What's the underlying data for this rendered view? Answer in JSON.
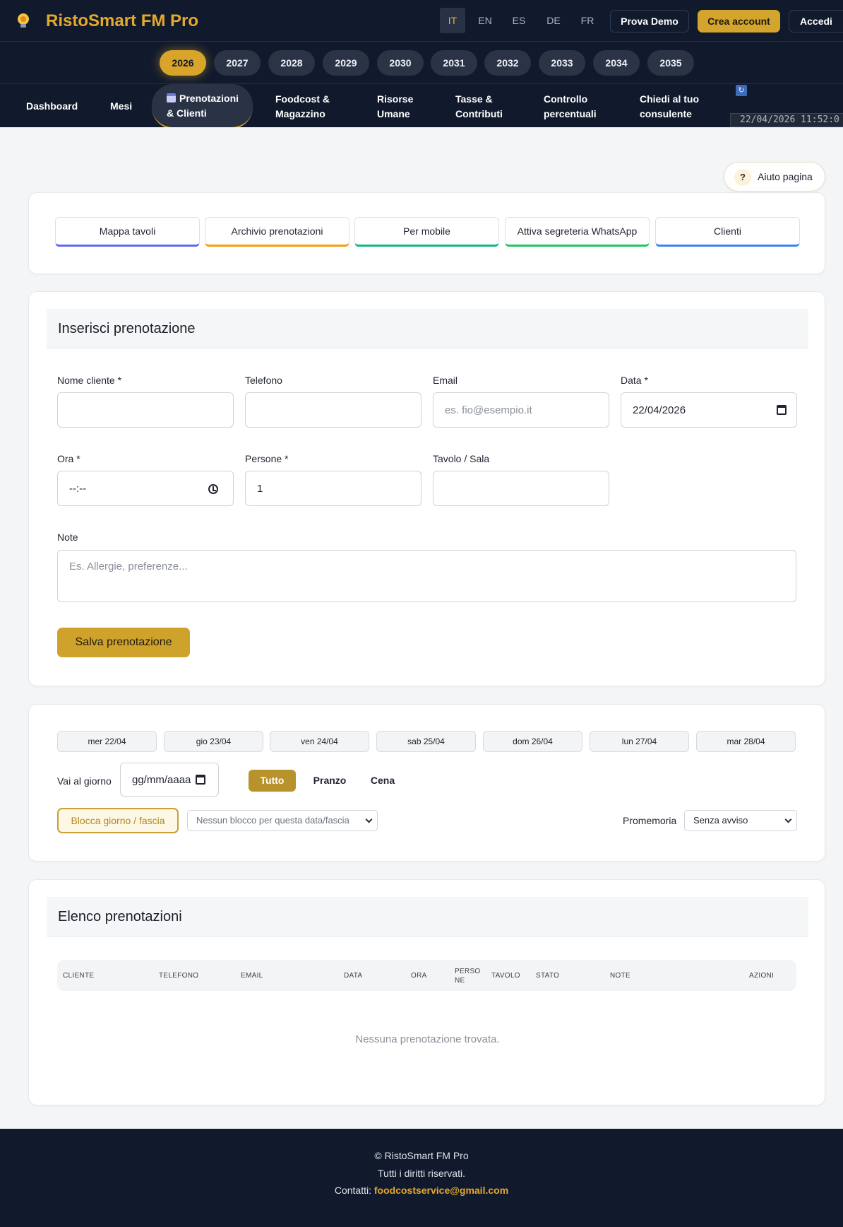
{
  "header": {
    "brand": "RistoSmart FM Pro",
    "languages": [
      "IT",
      "EN",
      "ES",
      "DE",
      "FR"
    ],
    "active_language": "IT",
    "demo_label": "Prova Demo",
    "create_label": "Crea account",
    "login_label": "Accedi"
  },
  "years": [
    "2026",
    "2027",
    "2028",
    "2029",
    "2030",
    "2031",
    "2032",
    "2033",
    "2034",
    "2035"
  ],
  "active_year": "2026",
  "nav": [
    {
      "line1": "Dashboard",
      "line2": ""
    },
    {
      "line1": "Mesi",
      "line2": ""
    },
    {
      "line1": "Prenotazioni",
      "line2": "& Clienti"
    },
    {
      "line1": "Foodcost &",
      "line2": "Magazzino"
    },
    {
      "line1": "Risorse",
      "line2": "Umane"
    },
    {
      "line1": "Tasse &",
      "line2": "Contributi"
    },
    {
      "line1": "Controllo",
      "line2": "percentuali"
    },
    {
      "line1": "Chiedi al tuo",
      "line2": "consulente"
    }
  ],
  "clock": "22/04/2026 11:52:0",
  "help_label": "Aiuto pagina",
  "tabs": [
    {
      "label": "Mappa tavoli",
      "color": "#6366f1"
    },
    {
      "label": "Archivio prenotazioni",
      "color": "#f59e0b"
    },
    {
      "label": "Per mobile",
      "color": "#10b981"
    },
    {
      "label": "Attiva segreteria WhatsApp",
      "color": "#22c55e"
    },
    {
      "label": "Clienti",
      "color": "#3b82f6"
    }
  ],
  "form": {
    "title": "Inserisci prenotazione",
    "name_label": "Nome cliente *",
    "phone_label": "Telefono",
    "email_label": "Email",
    "email_placeholder": "es. fio@esempio.it",
    "date_label": "Data *",
    "date_value": "22/04/2026",
    "time_label": "Ora *",
    "time_value": "--:--",
    "people_label": "Persone *",
    "people_value": "1",
    "table_label": "Tavolo / Sala",
    "notes_label": "Note",
    "notes_placeholder": "Es. Allergie, preferenze...",
    "save_label": "Salva prenotazione"
  },
  "calendar": {
    "days": [
      "mer 22/04",
      "gio 23/04",
      "ven 24/04",
      "sab 25/04",
      "dom 26/04",
      "lun 27/04",
      "mar 28/04"
    ],
    "goto_label": "Vai al giorno",
    "goto_placeholder": "gg/mm/aaaa",
    "filters": [
      "Tutto",
      "Pranzo",
      "Cena"
    ],
    "active_filter": "Tutto",
    "block_label": "Blocca giorno / fascia",
    "block_select": "Nessun blocco per questa data/fascia",
    "reminder_label": "Promemoria",
    "reminder_select": "Senza avviso"
  },
  "list": {
    "title": "Elenco prenotazioni",
    "columns": [
      "CLIENTE",
      "TELEFONO",
      "EMAIL",
      "DATA",
      "ORA",
      "PERSO NE",
      "TAVOLO",
      "STATO",
      "NOTE",
      "AZIONI"
    ],
    "empty": "Nessuna prenotazione trovata."
  },
  "footer": {
    "copyright": "© RistoSmart FM Pro",
    "rights": "Tutti i diritti riservati.",
    "contacts_label": "Contatti:",
    "email": "foodcostservice@gmail.com"
  }
}
